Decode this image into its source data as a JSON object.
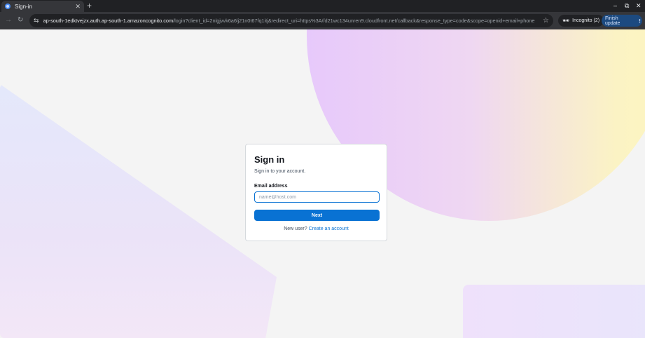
{
  "browser": {
    "tab": {
      "title": "Sign-in",
      "close_glyph": "✕"
    },
    "new_tab_glyph": "+",
    "window_controls": {
      "minimize": "–",
      "maximize": "⧉",
      "close": "✕"
    },
    "nav": {
      "back_glyph": "→",
      "reload_glyph": "↻"
    },
    "address_bar": {
      "host": "ap-south-1edktvejzx.auth.ap-south-1.amazoncognito.com",
      "path": "/login?client_id=2nlgjvvk6a6lj21n0t67fq1itj&redirect_uri=https%3A//d21wc134unren9.cloudfront.net/callback&response_type=code&scope=openid+email+phone",
      "site_info_glyph": "⇆",
      "bookmark_glyph": "☆"
    },
    "incognito": {
      "label": "Incognito (2)",
      "icon": "incognito-icon",
      "glyph": "🕶"
    },
    "finish_update": {
      "label": "Finish update",
      "menu_glyph": "⋮"
    }
  },
  "signin": {
    "title": "Sign in",
    "subtitle": "Sign in to your account.",
    "email": {
      "label": "Email address",
      "placeholder": "name@host.com",
      "value": ""
    },
    "next_button": "Next",
    "signup_prompt": "New user?",
    "signup_link": "Create an account"
  },
  "colors": {
    "primary": "#0972d3",
    "card_border": "#d5d9dd",
    "page_background": "#f4f4f4"
  }
}
